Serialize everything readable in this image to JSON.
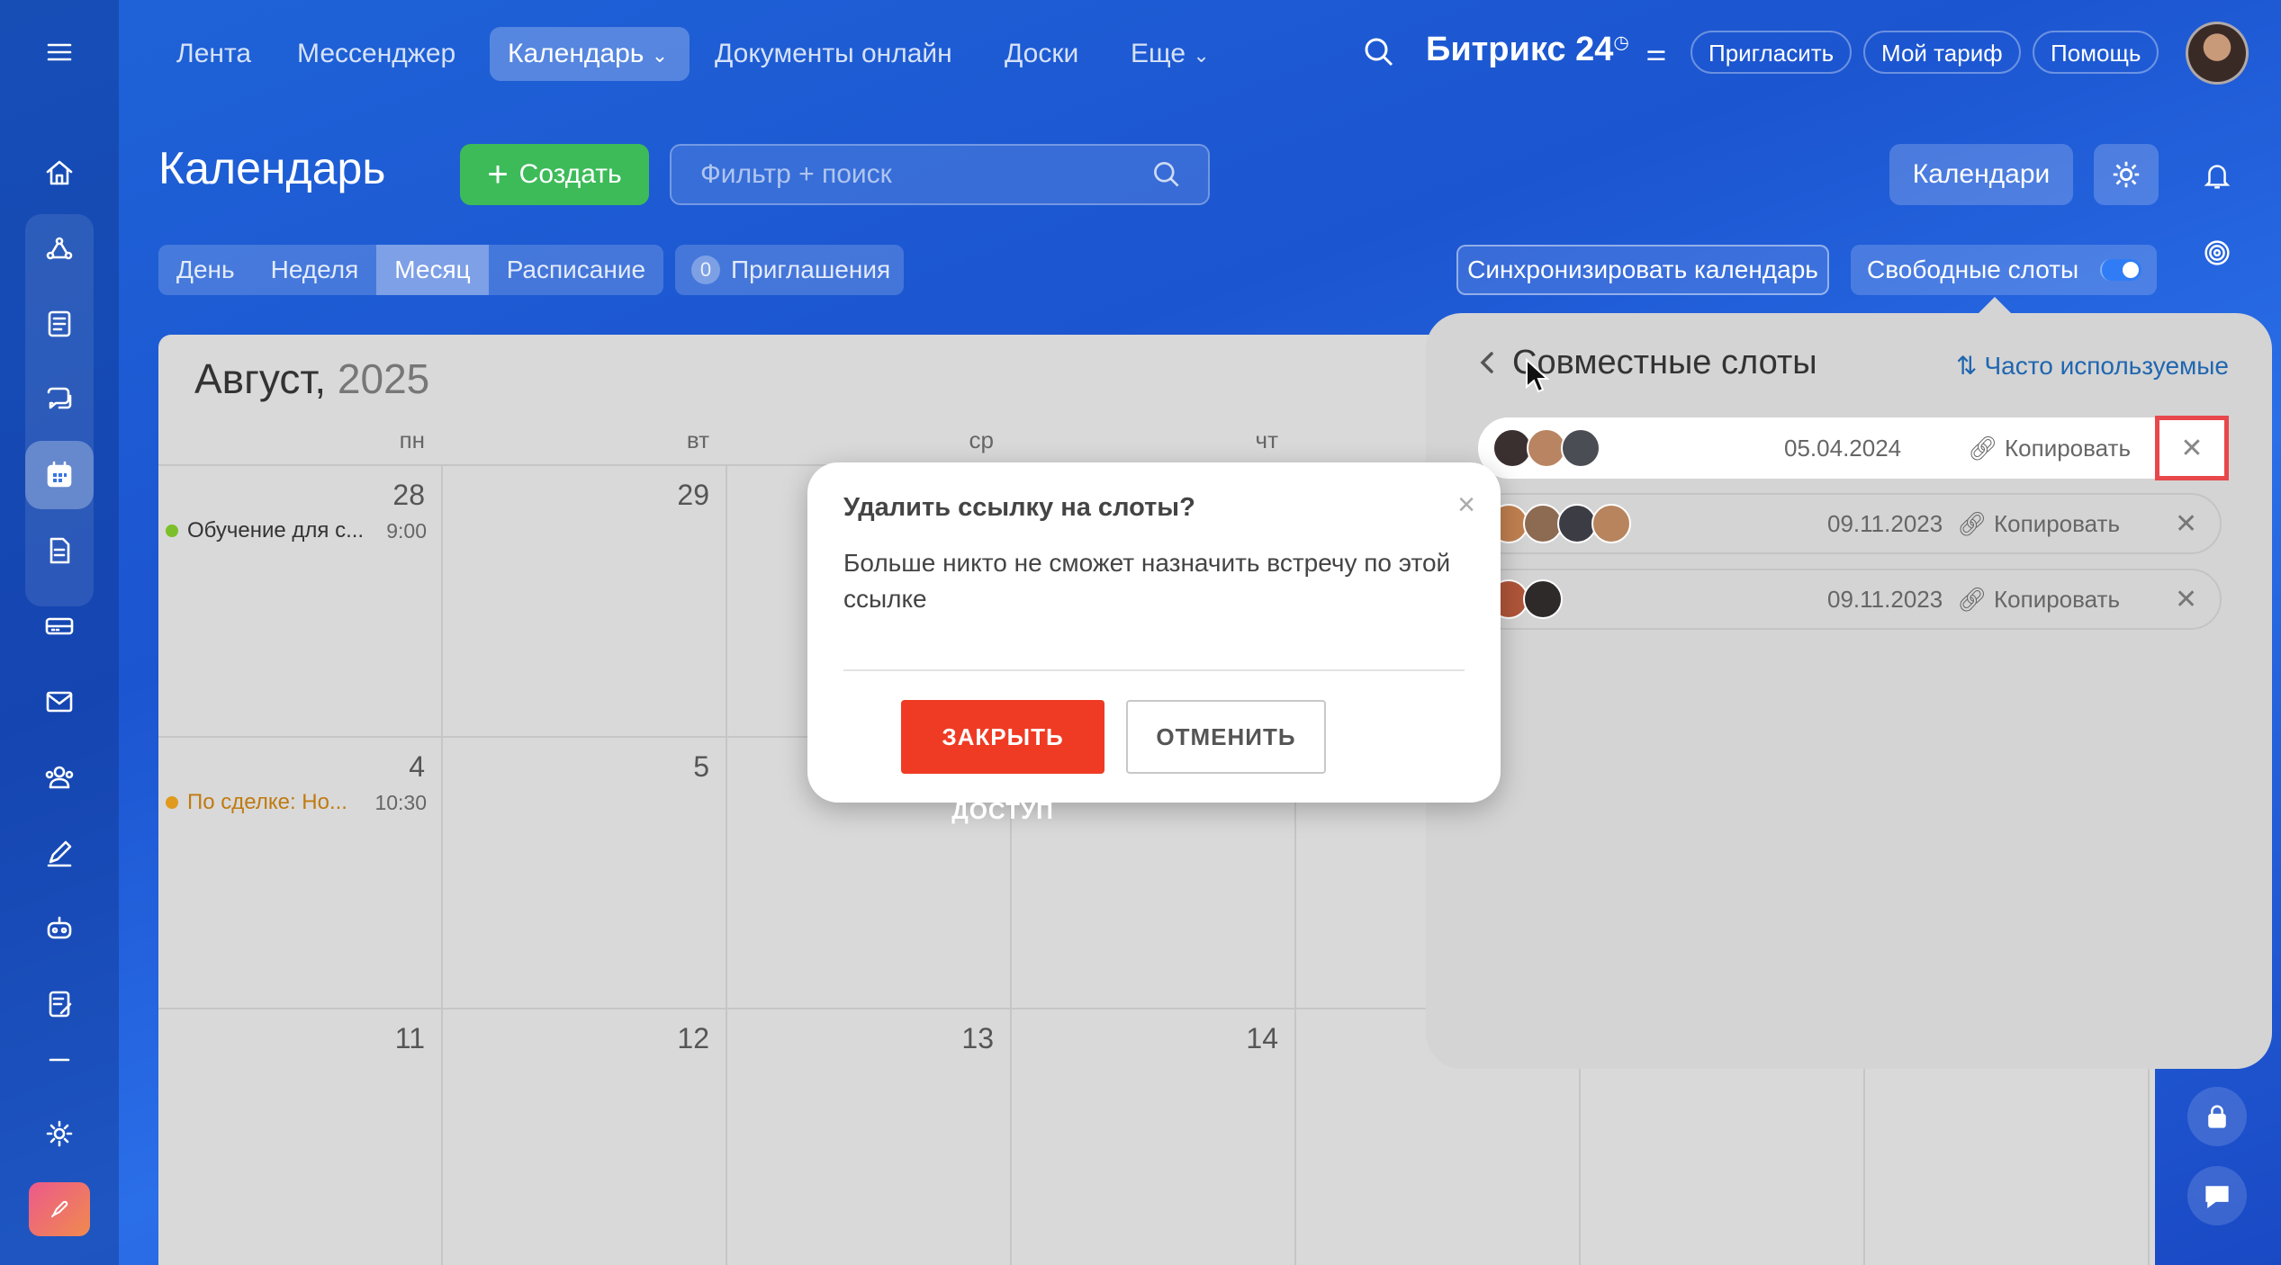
{
  "topnav": {
    "items": [
      "Лента",
      "Мессенджер",
      "Календарь",
      "Документы онлайн",
      "Доски",
      "Еще"
    ],
    "active_index": 2,
    "brand": "Битрикс",
    "brand_num": "24",
    "invite": "Пригласить",
    "tariff": "Мой тариф",
    "help": "Помощь"
  },
  "header": {
    "title": "Календарь",
    "create": "Создать",
    "search_placeholder": "Фильтр + поиск",
    "calendars": "Календари"
  },
  "views": {
    "tabs": [
      "День",
      "Неделя",
      "Месяц",
      "Расписание"
    ],
    "active_index": 2,
    "invites_count": "0",
    "invites_label": "Приглашения",
    "sync": "Синхронизировать календарь",
    "free_slots": "Свободные слоты",
    "free_slots_on": true
  },
  "calendar": {
    "month": "Август,",
    "year": "2025",
    "weekdays": [
      "пн",
      "вт",
      "ср",
      "чт"
    ],
    "weeks": [
      [
        "28",
        "29",
        "",
        ""
      ],
      [
        "4",
        "5",
        "",
        ""
      ],
      [
        "11",
        "12",
        "13",
        "14"
      ]
    ],
    "events": [
      {
        "label": "Обучение для с...",
        "time": "9:00",
        "color": "#7bbf2a"
      },
      {
        "label": "По сделке: Но...",
        "time": "10:30",
        "color": "#e09a1e"
      }
    ]
  },
  "slots_panel": {
    "title": "Совместные слоты",
    "frequent": "Часто используемые",
    "rows": [
      {
        "date": "05.04.2024",
        "copy": "Копировать",
        "avatar_colors": [
          "#3a3030",
          "#b98462",
          "#4b4d55"
        ]
      },
      {
        "date": "09.11.2023",
        "copy": "Копировать",
        "avatar_colors": [
          "#c08050",
          "#8d6a52",
          "#3c3c44",
          "#b7845e"
        ]
      },
      {
        "date": "09.11.2023",
        "copy": "Копировать",
        "avatar_colors": [
          "#b0553a",
          "#2f2a2a"
        ]
      }
    ]
  },
  "modal": {
    "title": "Удалить ссылку на слоты?",
    "body": "Больше никто не сможет назначить встречу по этой ссылке",
    "confirm": "ЗАКРЫТЬ ДОСТУП",
    "cancel": "ОТМЕНИТЬ"
  },
  "colors": {
    "accent_green": "#3dbb59",
    "danger": "#ef3b24",
    "link": "#2066b0",
    "highlight": "#e8474b"
  }
}
